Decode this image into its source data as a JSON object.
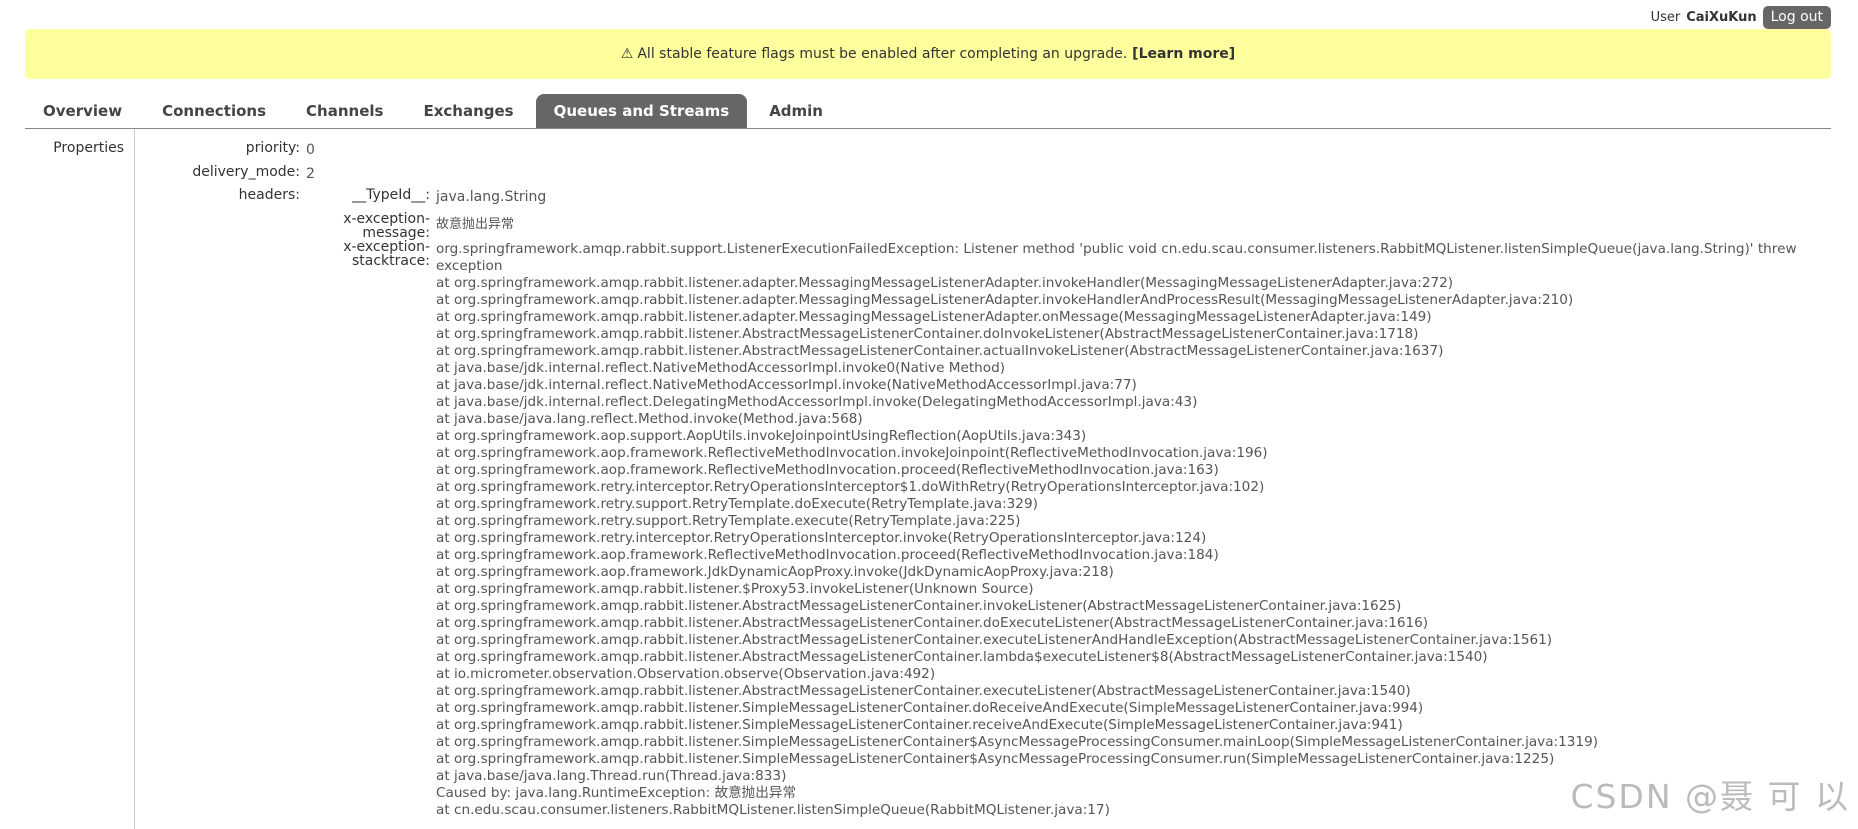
{
  "header": {
    "user_prefix": "User",
    "username": "CaiXuKun",
    "logout_label": "Log out"
  },
  "banner": {
    "icon": "warning-icon",
    "text": "All stable feature flags must be enabled after completing an upgrade.",
    "link": "[Learn more]",
    "bg_color": "#ffff9e"
  },
  "tabs": [
    {
      "label": "Overview"
    },
    {
      "label": "Connections"
    },
    {
      "label": "Channels"
    },
    {
      "label": "Exchanges"
    },
    {
      "label": "Queues and Streams",
      "active": true
    },
    {
      "label": "Admin"
    }
  ],
  "properties": {
    "section_label": "Properties",
    "priority_key": "priority:",
    "priority_val": "0",
    "delivery_key": "delivery_mode:",
    "delivery_val": "2",
    "headers_key": "headers:",
    "typeid_key": "__TypeId__:",
    "typeid_val": "java.lang.String",
    "xmsg_key_1": "x-exception-",
    "xmsg_key_2": "message:",
    "xmsg_val": "故意抛出异常",
    "xst_key_1": "x-exception-",
    "xst_key_2": "stacktrace:"
  },
  "stacktrace": {
    "head": "org.springframework.amqp.rabbit.support.ListenerExecutionFailedException: Listener method 'public void cn.edu.scau.consumer.listeners.RabbitMQListener.listenSimpleQueue(java.lang.String)' threw exception",
    "lines": [
      "at org.springframework.amqp.rabbit.listener.adapter.MessagingMessageListenerAdapter.invokeHandler(MessagingMessageListenerAdapter.java:272)",
      "at org.springframework.amqp.rabbit.listener.adapter.MessagingMessageListenerAdapter.invokeHandlerAndProcessResult(MessagingMessageListenerAdapter.java:210)",
      "at org.springframework.amqp.rabbit.listener.adapter.MessagingMessageListenerAdapter.onMessage(MessagingMessageListenerAdapter.java:149)",
      "at org.springframework.amqp.rabbit.listener.AbstractMessageListenerContainer.doInvokeListener(AbstractMessageListenerContainer.java:1718)",
      "at org.springframework.amqp.rabbit.listener.AbstractMessageListenerContainer.actualInvokeListener(AbstractMessageListenerContainer.java:1637)",
      "at java.base/jdk.internal.reflect.NativeMethodAccessorImpl.invoke0(Native Method)",
      "at java.base/jdk.internal.reflect.NativeMethodAccessorImpl.invoke(NativeMethodAccessorImpl.java:77)",
      "at java.base/jdk.internal.reflect.DelegatingMethodAccessorImpl.invoke(DelegatingMethodAccessorImpl.java:43)",
      "at java.base/java.lang.reflect.Method.invoke(Method.java:568)",
      "at org.springframework.aop.support.AopUtils.invokeJoinpointUsingReflection(AopUtils.java:343)",
      "at org.springframework.aop.framework.ReflectiveMethodInvocation.invokeJoinpoint(ReflectiveMethodInvocation.java:196)",
      "at org.springframework.aop.framework.ReflectiveMethodInvocation.proceed(ReflectiveMethodInvocation.java:163)",
      "at org.springframework.retry.interceptor.RetryOperationsInterceptor$1.doWithRetry(RetryOperationsInterceptor.java:102)",
      "at org.springframework.retry.support.RetryTemplate.doExecute(RetryTemplate.java:329)",
      "at org.springframework.retry.support.RetryTemplate.execute(RetryTemplate.java:225)",
      "at org.springframework.retry.interceptor.RetryOperationsInterceptor.invoke(RetryOperationsInterceptor.java:124)",
      "at org.springframework.aop.framework.ReflectiveMethodInvocation.proceed(ReflectiveMethodInvocation.java:184)",
      "at org.springframework.aop.framework.JdkDynamicAopProxy.invoke(JdkDynamicAopProxy.java:218)",
      "at org.springframework.amqp.rabbit.listener.$Proxy53.invokeListener(Unknown Source)",
      "at org.springframework.amqp.rabbit.listener.AbstractMessageListenerContainer.invokeListener(AbstractMessageListenerContainer.java:1625)",
      "at org.springframework.amqp.rabbit.listener.AbstractMessageListenerContainer.doExecuteListener(AbstractMessageListenerContainer.java:1616)",
      "at org.springframework.amqp.rabbit.listener.AbstractMessageListenerContainer.executeListenerAndHandleException(AbstractMessageListenerContainer.java:1561)",
      "at org.springframework.amqp.rabbit.listener.AbstractMessageListenerContainer.lambda$executeListener$8(AbstractMessageListenerContainer.java:1540)",
      "at io.micrometer.observation.Observation.observe(Observation.java:492)",
      "at org.springframework.amqp.rabbit.listener.AbstractMessageListenerContainer.executeListener(AbstractMessageListenerContainer.java:1540)",
      "at org.springframework.amqp.rabbit.listener.SimpleMessageListenerContainer.doReceiveAndExecute(SimpleMessageListenerContainer.java:994)",
      "at org.springframework.amqp.rabbit.listener.SimpleMessageListenerContainer.receiveAndExecute(SimpleMessageListenerContainer.java:941)",
      "at org.springframework.amqp.rabbit.listener.SimpleMessageListenerContainer$AsyncMessageProcessingConsumer.mainLoop(SimpleMessageListenerContainer.java:1319)",
      "at org.springframework.amqp.rabbit.listener.SimpleMessageListenerContainer$AsyncMessageProcessingConsumer.run(SimpleMessageListenerContainer.java:1225)",
      "at java.base/java.lang.Thread.run(Thread.java:833)",
      "Caused by: java.lang.RuntimeException: 故意抛出异常",
      "at cn.edu.scau.consumer.listeners.RabbitMQListener.listenSimpleQueue(RabbitMQListener.java:17)"
    ]
  },
  "watermark": "CSDN @聂 可 以"
}
